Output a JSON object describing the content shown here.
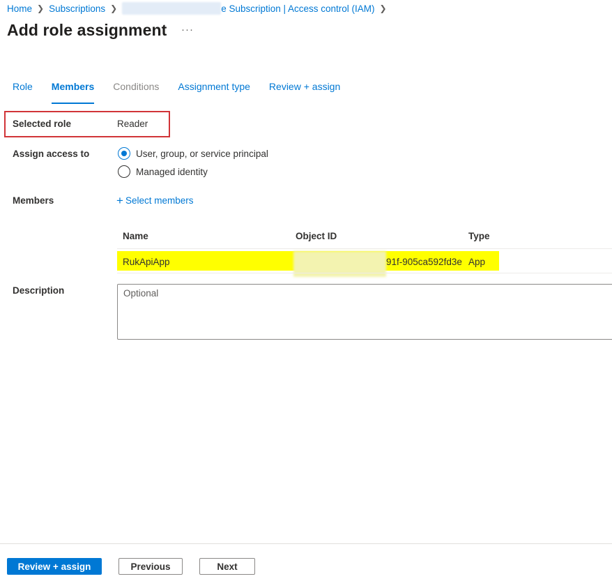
{
  "breadcrumb": {
    "home": "Home",
    "subscriptions": "Subscriptions",
    "current": "e Subscription | Access control (IAM)"
  },
  "page": {
    "title": "Add role assignment",
    "more": "···"
  },
  "tabs": [
    {
      "label": "Role",
      "state": "normal"
    },
    {
      "label": "Members",
      "state": "active"
    },
    {
      "label": "Conditions",
      "state": "disabled"
    },
    {
      "label": "Assignment type",
      "state": "normal"
    },
    {
      "label": "Review + assign",
      "state": "normal"
    }
  ],
  "form": {
    "selected_role_label": "Selected role",
    "selected_role_value": "Reader",
    "assign_access_label": "Assign access to",
    "assign_options": [
      {
        "label": "User, group, or service principal",
        "checked": true
      },
      {
        "label": "Managed identity",
        "checked": false
      }
    ],
    "members_label": "Members",
    "select_members": "Select members",
    "description_label": "Description",
    "description_placeholder": "Optional"
  },
  "members_table": {
    "columns": [
      "Name",
      "Object ID",
      "Type"
    ],
    "rows": [
      {
        "name": "RukApiApp",
        "object_id": "91f-905ca592fd3e",
        "type": "App"
      }
    ]
  },
  "footer": {
    "review_assign": "Review + assign",
    "previous": "Previous",
    "next": "Next"
  },
  "colors": {
    "accent": "#0078d4",
    "highlight": "#ffff00",
    "annotation_box": "#d13438"
  }
}
